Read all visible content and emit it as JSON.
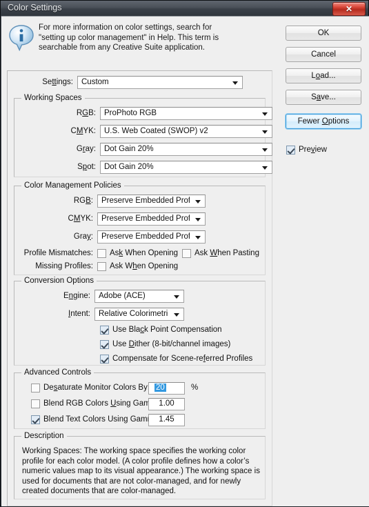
{
  "window": {
    "title": "Color Settings",
    "close_label": "✕",
    "close_icon": "close-icon"
  },
  "header": {
    "icon": "info-icon",
    "text": "For more information on color settings, search for \"setting up color management\" in Help. This term is searchable from any Creative Suite application."
  },
  "settings": {
    "label": "Settings:",
    "value": "Custom"
  },
  "working_spaces": {
    "title": "Working Spaces",
    "rows": [
      {
        "label_pre": "R",
        "label_mn": "G",
        "label_post": "B:",
        "label": "RGB:",
        "value": "ProPhoto RGB"
      },
      {
        "label": "CMYK:",
        "value": "U.S. Web Coated (SWOP) v2"
      },
      {
        "label": "Gray:",
        "value": "Dot Gain 20%"
      },
      {
        "label": "Spot:",
        "value": "Dot Gain 20%"
      }
    ]
  },
  "policies": {
    "title": "Color Management Policies",
    "rows": [
      {
        "label": "RGB:",
        "value": "Preserve Embedded Profiles"
      },
      {
        "label": "CMYK:",
        "value": "Preserve Embedded Profiles"
      },
      {
        "label": "Gray:",
        "value": "Preserve Embedded Profiles"
      }
    ],
    "mismatches_label": "Profile Mismatches:",
    "missing_label": "Missing Profiles:",
    "ask_opening_1": "Ask When Opening",
    "ask_pasting": "Ask When Pasting",
    "ask_opening_2": "Ask When Opening",
    "ask_opening_1_checked": false,
    "ask_pasting_checked": false,
    "ask_opening_2_checked": false
  },
  "conversion": {
    "title": "Conversion Options",
    "engine_label": "Engine:",
    "engine_value": "Adobe (ACE)",
    "intent_label": "Intent:",
    "intent_value": "Relative Colorimetric",
    "checks": [
      {
        "label": "Use Black Point Compensation",
        "checked": true
      },
      {
        "label": "Use Dither (8-bit/channel images)",
        "checked": true
      },
      {
        "label": "Compensate for Scene-referred Profiles",
        "checked": true
      }
    ]
  },
  "advanced": {
    "title": "Advanced Controls",
    "rows": [
      {
        "label": "Desaturate Monitor Colors By:",
        "checked": false,
        "value": "20",
        "suffix": "%",
        "selected": true
      },
      {
        "label": "Blend RGB Colors Using Gamma:",
        "checked": false,
        "value": "1.00",
        "suffix": "",
        "selected": false
      },
      {
        "label": "Blend Text Colors Using Gamma:",
        "checked": true,
        "value": "1.45",
        "suffix": "",
        "selected": false
      }
    ]
  },
  "description": {
    "title": "Description",
    "body": "Working Spaces:  The working space specifies the working color profile for each color model.  (A color profile defines how a color’s numeric values map to its visual appearance.)  The working space is used for documents that are not color-managed, and for newly created documents that are color-managed."
  },
  "buttons": {
    "ok": "OK",
    "cancel": "Cancel",
    "load": "Load...",
    "save": "Save...",
    "fewer_options": "Fewer Options",
    "preview_label": "Preview",
    "preview_checked": true
  },
  "colors": {
    "accent": "#3a9ad9",
    "selection": "#3399e0",
    "dialog_bg": "#efefef",
    "close_red": "#b52b1e"
  }
}
